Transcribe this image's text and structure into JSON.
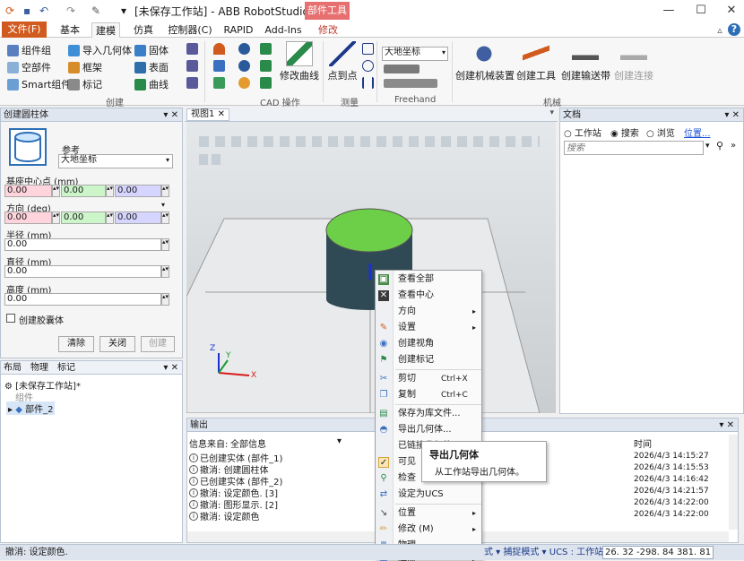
{
  "window": {
    "title": "[未保存工作站] - ABB RobotStudio 6.08",
    "context_tab_badge": "部件工具",
    "qa_dropdown": "▾",
    "minimize": "—",
    "maximize": "☐",
    "close": "✕"
  },
  "ribbon_tabs": [
    "文件(F)",
    "基本",
    "建模",
    "仿真",
    "控制器(C)",
    "RAPID",
    "Add-Ins",
    "修改"
  ],
  "ribbon": {
    "create": {
      "group_label": "创建",
      "items": [
        "组件组",
        "空部件",
        "Smart组件",
        "导入几何体",
        "框架",
        "标记",
        "固体",
        "表面",
        "曲线"
      ]
    },
    "cad": {
      "group_label": "CAD 操作",
      "modify_curve": "修改曲线"
    },
    "measure": {
      "group_label": "测量",
      "point_to_point": "点到点"
    },
    "freehand": {
      "group_label": "Freehand",
      "coord_select": "大地坐标"
    },
    "mechanism": {
      "group_label": "机械",
      "create_mechanism": "创建机械装置",
      "create_tool": "创建工具",
      "create_conveyor": "创建输送带",
      "create_connection": "创建连接"
    },
    "help": "?",
    "collapse": "▵"
  },
  "create_cylinder_panel": {
    "title": "创建圆柱体",
    "controls": "▾ ✕",
    "reference_label": "参考",
    "reference_value": "大地坐标",
    "base_center_label": "基座中心点 (mm)",
    "base_center": [
      "0.00",
      "0.00",
      "0.00"
    ],
    "orientation_label": "方向 (deg)",
    "orientation": [
      "0.00",
      "0.00",
      "0.00"
    ],
    "radius_label": "半径 (mm)",
    "radius": "0.00",
    "diameter_label": "直径 (mm)",
    "diameter": "0.00",
    "height_label": "高度 (mm)",
    "height": "0.00",
    "capsule_label": "创建胶囊体",
    "clear_btn": "清除",
    "close_btn": "关闭",
    "create_btn": "创建"
  },
  "layout_panel": {
    "tabs": [
      "布局",
      "物理",
      "标记"
    ],
    "controls": "▾ ✕",
    "station": "[未保存工作站]*",
    "group_label": "组件",
    "part": "部件_2"
  },
  "view": {
    "tab_label": "视图1",
    "tab_close": "✕",
    "axis_x": "X",
    "axis_y": "Y",
    "axis_z": "Z"
  },
  "documents_panel": {
    "title": "文档",
    "controls": "▾ ✕",
    "radio_station": "工作站",
    "radio_search": "搜索",
    "radio_browse": "浏览",
    "location_link": "位置...",
    "search_placeholder": "搜索"
  },
  "output_panel": {
    "title": "输出",
    "controls": "▾ ✕",
    "source_label": "信息来自:",
    "source_value": "全部信息",
    "time_header": "时间",
    "messages": [
      {
        "text": "已创建实体 (部件_1)",
        "time": "2026/4/3 14:15:27"
      },
      {
        "text": "撤消: 创建圆柱体",
        "time": "2026/4/3 14:15:53"
      },
      {
        "text": "已创建实体 (部件_2)",
        "time": "2026/4/3 14:16:42"
      },
      {
        "text": "撤消: 设定颜色. [3]",
        "time": "2026/4/3 14:21:57"
      },
      {
        "text": "撤消: 图形显示. [2]",
        "time": "2026/4/3 14:22:00"
      },
      {
        "text": "撤消: 设定颜色",
        "time": "2026/4/3 14:22:00"
      }
    ]
  },
  "context_menu": {
    "items": [
      {
        "label": "查看全部"
      },
      {
        "label": "查看中心"
      },
      {
        "label": "方向",
        "arrow": "▸"
      },
      {
        "label": "设置",
        "arrow": "▸"
      },
      {
        "label": "创建视角"
      },
      {
        "label": "创建标记"
      },
      {
        "label": "剪切",
        "shortcut": "Ctrl+X"
      },
      {
        "label": "复制",
        "shortcut": "Ctrl+C"
      },
      {
        "label": "保存为库文件..."
      },
      {
        "label": "导出几何体..."
      },
      {
        "label": "已链接几何体"
      },
      {
        "label": "可见"
      },
      {
        "label": "检查"
      },
      {
        "label": "设定为UCS"
      },
      {
        "label": "位置",
        "arrow": "▸"
      },
      {
        "label": "修改 (M)",
        "arrow": "▸"
      },
      {
        "label": "物理",
        "arrow": "▸"
      },
      {
        "label": "映射",
        "arrow": "▸"
      }
    ]
  },
  "tooltip": {
    "title": "导出几何体",
    "desc": "从工作站导出几何体。"
  },
  "status": {
    "left": "撤消: 设定颜色.",
    "mode_text": "式 ▾ 捕捉模式 ▾ UCS : 工作站",
    "coords": "26. 32  -298. 84  381. 81"
  }
}
